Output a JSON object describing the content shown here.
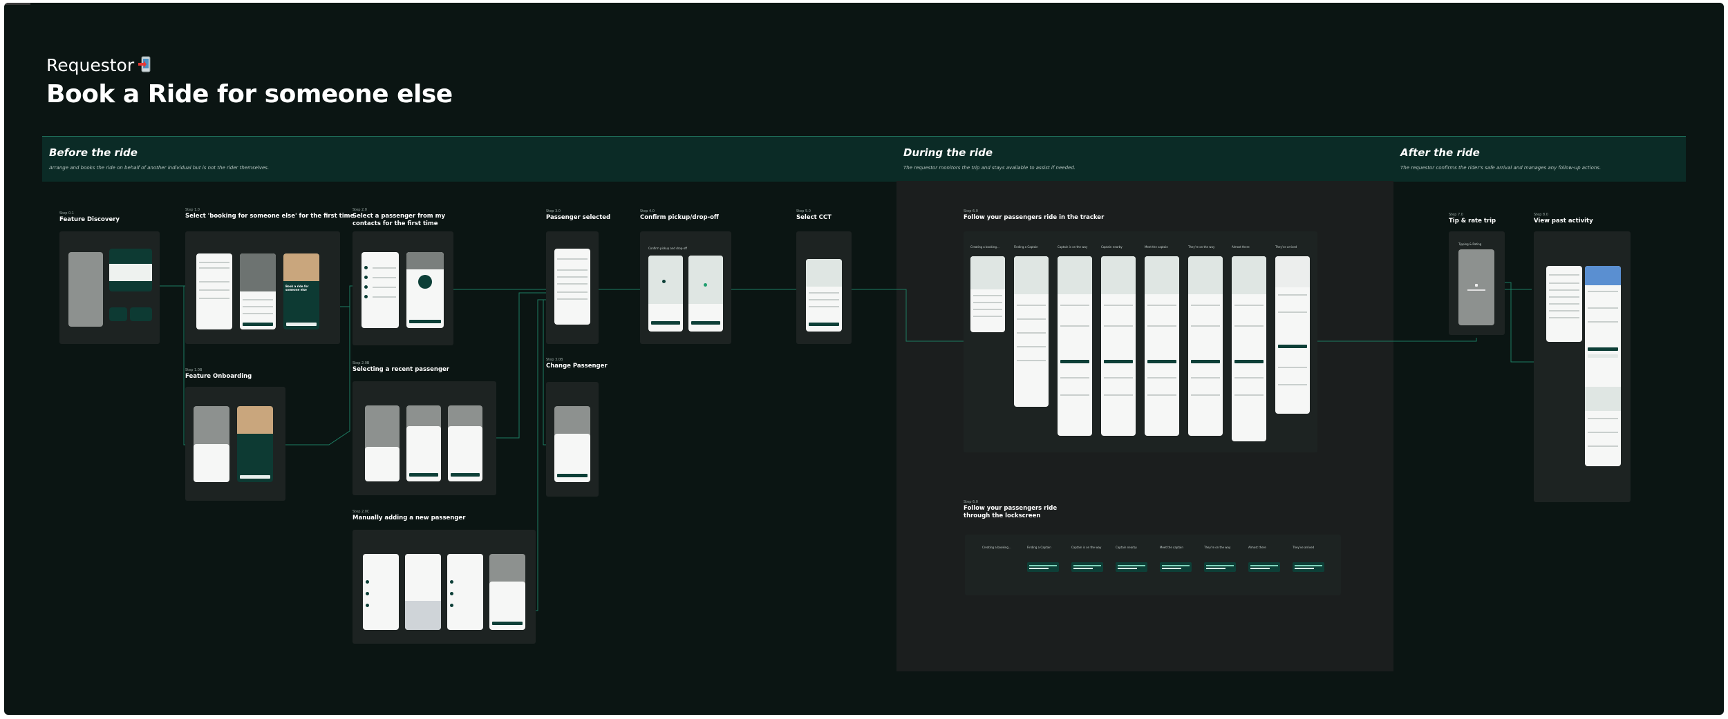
{
  "header": {
    "eyebrow": "Requestor",
    "eyebrow_icon": "phone-arrow-icon",
    "title": "Book a Ride for someone else"
  },
  "phases": [
    {
      "title": "Before the ride",
      "description": "Arrange and books the ride on behalf of another individual but is not the rider themselves."
    },
    {
      "title": "During the ride",
      "description": "The requestor monitors the trip and stays available to assist if needed."
    },
    {
      "title": "After the ride",
      "description": "The requestor confirms the rider's safe arrival and manages any follow-up actions."
    }
  ],
  "steps": {
    "s01": {
      "label": "Step 0.1",
      "title": "Feature Discovery"
    },
    "s10": {
      "label": "Step 1.0",
      "title": "Select 'booking for someone else' for the first time"
    },
    "s10b": {
      "label": "Step 1.0B",
      "title": "Feature Onboarding"
    },
    "s20": {
      "label": "Step 2.0",
      "title": "Select a passenger from my contacts for the first time"
    },
    "s20b": {
      "label": "Step 2.0B",
      "title": "Selecting a recent passenger"
    },
    "s20c": {
      "label": "Step 2.0C",
      "title": "Manually adding a new passenger"
    },
    "s30": {
      "label": "Step 3.0",
      "title": "Passenger selected"
    },
    "s30b": {
      "label": "Step 3.0B",
      "title": "Change Passenger"
    },
    "s40": {
      "label": "Step 4.0",
      "title": "Confirm pickup/drop-off"
    },
    "s50": {
      "label": "Step 5.0",
      "title": "Select CCT"
    },
    "s60": {
      "label": "Step 6.0",
      "title": "Follow your passengers ride in the tracker"
    },
    "s60b": {
      "label": "Step 6.0",
      "title": "Follow your passengers ride through the lockscreen"
    },
    "s70": {
      "label": "Step 7.0",
      "title": "Tip & rate trip"
    },
    "s80": {
      "label": "Step 8.0",
      "title": "View past activity"
    }
  },
  "screens": {
    "onboarding_title": "Book a ride for someone else",
    "confirm_pickup": "Confirm pickup and drop-off",
    "tip_rate": "Tipping & Rating"
  },
  "tracker_screens": [
    "Creating a booking...",
    "Finding a Captain",
    "Captain is on the way",
    "Captain nearby",
    "Meet the captain",
    "They're on the way",
    "Almost there",
    "They've arrived"
  ],
  "lockscreen_screens": [
    "Creating a booking...",
    "Finding a Captain",
    "Captain is on the way",
    "Captain nearby",
    "Meet the captain",
    "They're on the way",
    "Almost there",
    "They've arrived"
  ]
}
